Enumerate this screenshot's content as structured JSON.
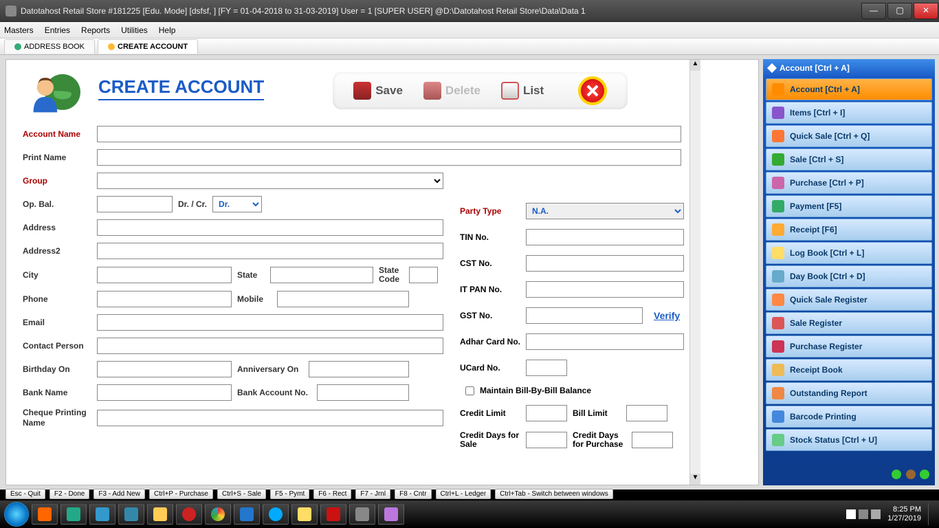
{
  "titlebar": "Datotahost Retail Store #181225  [Edu. Mode]  [dsfsf, ] [FY = 01-04-2018 to 31-03-2019] User = 1 [SUPER USER]  @D:\\Datotahost Retail Store\\Data\\Data 1",
  "menu": {
    "masters": "Masters",
    "entries": "Entries",
    "reports": "Reports",
    "utilities": "Utilities",
    "help": "Help"
  },
  "tabs": {
    "addressbook": "ADDRESS BOOK",
    "createaccount": "CREATE ACCOUNT"
  },
  "page_title": "CREATE ACCOUNT",
  "actions": {
    "save": "Save",
    "delete": "Delete",
    "list": "List"
  },
  "labels": {
    "account_name": "Account Name",
    "print_name": "Print Name",
    "group": "Group",
    "op_bal": "Op. Bal.",
    "drcr": "Dr. / Cr.",
    "drcr_value": "Dr.",
    "address": "Address",
    "address2": "Address2",
    "city": "City",
    "state": "State",
    "state_code": "State Code",
    "phone": "Phone",
    "mobile": "Mobile",
    "email": "Email",
    "contact_person": "Contact Person",
    "birthday": "Birthday On",
    "anniversary": "Anniversary On",
    "bank_name": "Bank Name",
    "bank_account_no": "Bank Account No.",
    "cheque_name": "Cheque Printing Name",
    "party_type": "Party Type",
    "party_type_value": "N.A.",
    "tin": "TIN No.",
    "cst": "CST No.",
    "itpan": "IT PAN No.",
    "gst": "GST No.",
    "verify": "Verify",
    "adhar": "Adhar Card No.",
    "ucard": "UCard No.",
    "maintain_bbb": "Maintain Bill-By-Bill Balance",
    "credit_limit": "Credit Limit",
    "bill_limit": "Bill Limit",
    "credit_days_sale": "Credit Days for Sale",
    "credit_days_purchase": "Credit Days for Purchase"
  },
  "sidepanel": {
    "header": "Account [Ctrl + A]",
    "items": [
      {
        "label": "Account [Ctrl + A]",
        "active": true,
        "color": "#ff8c00"
      },
      {
        "label": "Items [Ctrl + I]",
        "color": "#8855cc"
      },
      {
        "label": "Quick Sale [Ctrl + Q]",
        "color": "#ff7733"
      },
      {
        "label": "Sale [Ctrl + S]",
        "color": "#33aa33"
      },
      {
        "label": "Purchase [Ctrl + P]",
        "color": "#cc66aa"
      },
      {
        "label": "Payment [F5]",
        "color": "#33aa66"
      },
      {
        "label": "Receipt [F6]",
        "color": "#ffaa33"
      },
      {
        "label": "Log Book [Ctrl + L]",
        "color": "#ffdd66"
      },
      {
        "label": "Day Book [Ctrl + D]",
        "color": "#66aacc"
      },
      {
        "label": "Quick Sale Register",
        "color": "#ff8844"
      },
      {
        "label": "Sale Register",
        "color": "#dd5555"
      },
      {
        "label": "Purchase Register",
        "color": "#cc3355"
      },
      {
        "label": "Receipt Book",
        "color": "#eebb55"
      },
      {
        "label": "Outstanding Report",
        "color": "#ee8844"
      },
      {
        "label": "Barcode Printing",
        "color": "#4488dd"
      },
      {
        "label": "Stock Status [Ctrl + U]",
        "color": "#66cc88"
      }
    ]
  },
  "fkeys": [
    "Esc - Quit",
    "F2 - Done",
    "F3 - Add New",
    "Ctrl+P - Purchase",
    "Ctrl+S - Sale",
    "F5 - Pymt",
    "F6 - Rect",
    "F7 - Jrnl",
    "F8 - Cntr",
    "Ctrl+L - Ledger",
    "Ctrl+Tab - Switch between windows"
  ],
  "clock": {
    "time": "8:25 PM",
    "date": "1/27/2019"
  }
}
